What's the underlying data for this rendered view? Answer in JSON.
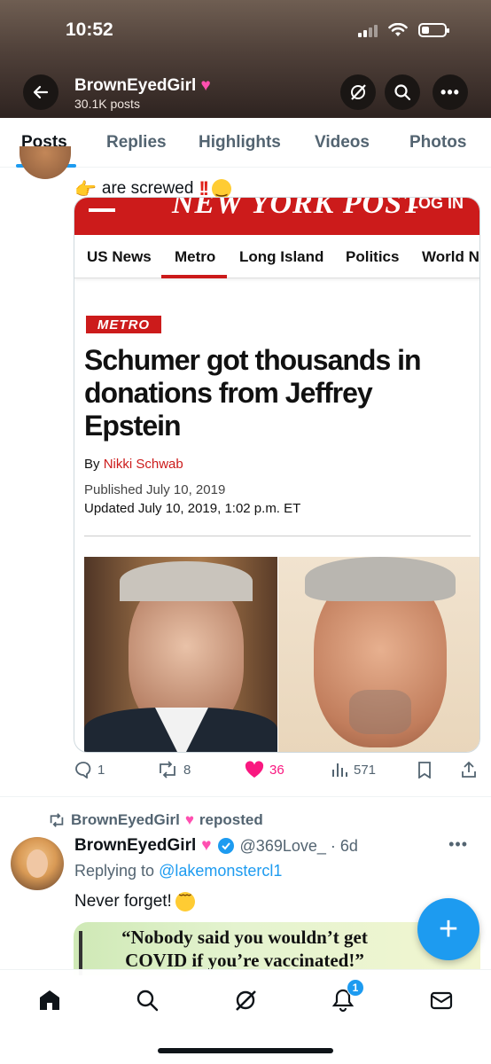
{
  "status_bar": {
    "time": "10:52"
  },
  "header": {
    "name": "BrownEyedGirl",
    "posts": "30.1K posts"
  },
  "tabs": [
    {
      "label": "Posts",
      "active": true
    },
    {
      "label": "Replies"
    },
    {
      "label": "Highlights"
    },
    {
      "label": "Videos"
    },
    {
      "label": "Photos"
    }
  ],
  "tweet1": {
    "text": "are screwed",
    "card": {
      "logo": "NEW YORK POST",
      "login": "LOG IN",
      "nav": [
        "US News",
        "Metro",
        "Long Island",
        "Politics",
        "World News"
      ],
      "section": "METRO",
      "headline": "Schumer got thousands in donations from Jeffrey Epstein",
      "byline_prefix": "By",
      "author": "Nikki Schwab",
      "published": "Published July 10, 2019",
      "updated": "Updated July 10, 2019, 1:02 p.m. ET"
    },
    "actions": {
      "replies": "1",
      "reposts": "8",
      "likes": "36",
      "views": "571"
    }
  },
  "tweet2": {
    "repost_label": "BrownEyedGirl",
    "reposted": "reposted",
    "name": "BrownEyedGirl",
    "handle": "@369Love_ · 6d",
    "replying_prefix": "Replying to",
    "replying_to": "@lakemonstercl1",
    "text": "Never forget!",
    "card_text": "“Nobody said you wouldn’t get COVID if you’re vaccinated!”"
  },
  "bottom_nav": {
    "notification_count": "1"
  },
  "colors": {
    "accent": "#1d9bf0",
    "like": "#f91880",
    "nyp_red": "#cc1b1b"
  }
}
